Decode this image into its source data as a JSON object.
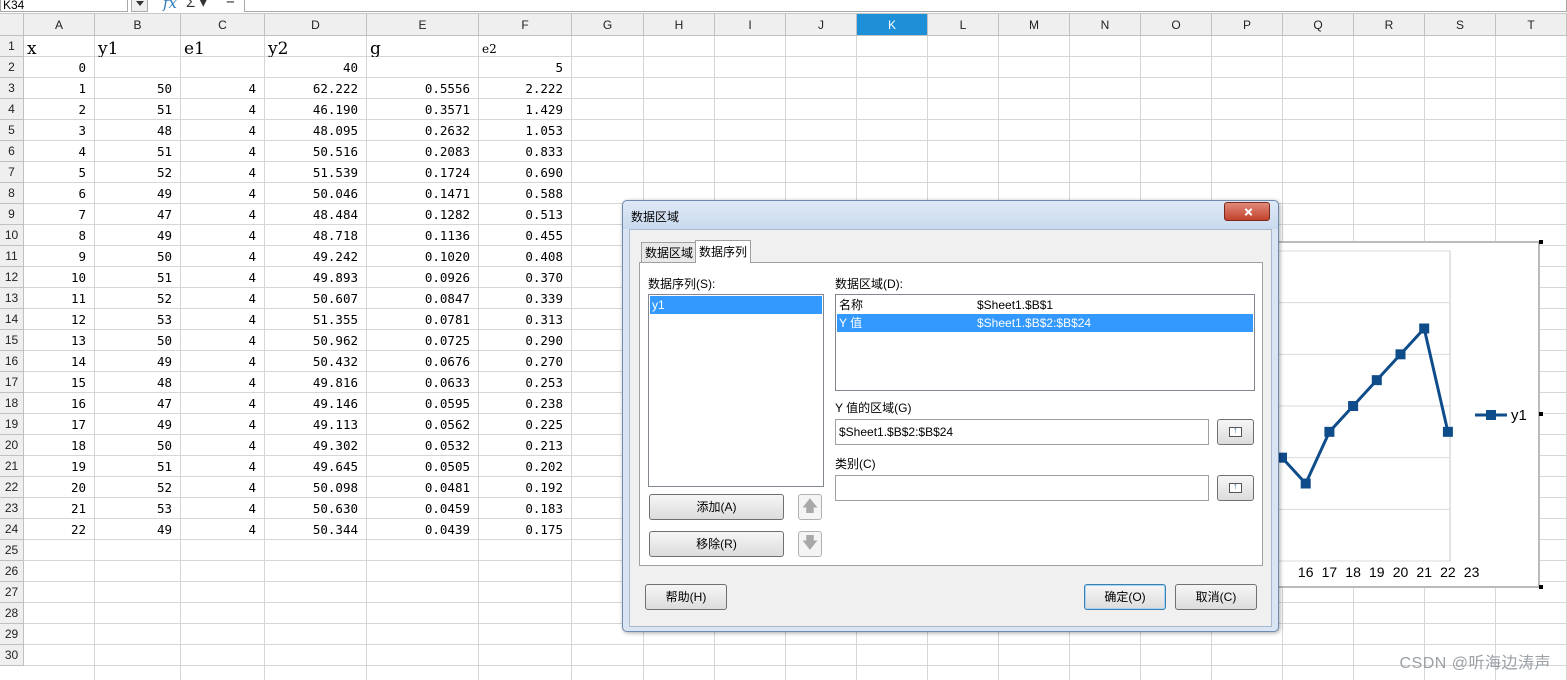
{
  "formula_bar": {
    "name_box": "K34",
    "fx_label": "fx",
    "sigma_label": "Σ ▾",
    "equals_label": "="
  },
  "columns": [
    "A",
    "B",
    "C",
    "D",
    "E",
    "F",
    "G",
    "H",
    "I",
    "J",
    "K",
    "L",
    "M",
    "N",
    "O",
    "P",
    "Q",
    "R",
    "S",
    "T"
  ],
  "active_column": "K",
  "rows": [
    "1",
    "2",
    "3",
    "4",
    "5",
    "6",
    "7",
    "8",
    "9",
    "10",
    "11",
    "12",
    "13",
    "14",
    "15",
    "16",
    "17",
    "18",
    "19",
    "20",
    "21",
    "22",
    "23",
    "24",
    "25",
    "26",
    "27",
    "28",
    "29",
    "30"
  ],
  "sheet": {
    "header": [
      "x",
      "y1",
      "e1",
      "y2",
      "g",
      "e2"
    ],
    "data": [
      [
        "0",
        "",
        "",
        "40",
        "",
        "5"
      ],
      [
        "1",
        "50",
        "4",
        "62.222",
        "0.5556",
        "2.222"
      ],
      [
        "2",
        "51",
        "4",
        "46.190",
        "0.3571",
        "1.429"
      ],
      [
        "3",
        "48",
        "4",
        "48.095",
        "0.2632",
        "1.053"
      ],
      [
        "4",
        "51",
        "4",
        "50.516",
        "0.2083",
        "0.833"
      ],
      [
        "5",
        "52",
        "4",
        "51.539",
        "0.1724",
        "0.690"
      ],
      [
        "6",
        "49",
        "4",
        "50.046",
        "0.1471",
        "0.588"
      ],
      [
        "7",
        "47",
        "4",
        "48.484",
        "0.1282",
        "0.513"
      ],
      [
        "8",
        "49",
        "4",
        "48.718",
        "0.1136",
        "0.455"
      ],
      [
        "9",
        "50",
        "4",
        "49.242",
        "0.1020",
        "0.408"
      ],
      [
        "10",
        "51",
        "4",
        "49.893",
        "0.0926",
        "0.370"
      ],
      [
        "11",
        "52",
        "4",
        "50.607",
        "0.0847",
        "0.339"
      ],
      [
        "12",
        "53",
        "4",
        "51.355",
        "0.0781",
        "0.313"
      ],
      [
        "13",
        "50",
        "4",
        "50.962",
        "0.0725",
        "0.290"
      ],
      [
        "14",
        "49",
        "4",
        "50.432",
        "0.0676",
        "0.270"
      ],
      [
        "15",
        "48",
        "4",
        "49.816",
        "0.0633",
        "0.253"
      ],
      [
        "16",
        "47",
        "4",
        "49.146",
        "0.0595",
        "0.238"
      ],
      [
        "17",
        "49",
        "4",
        "49.113",
        "0.0562",
        "0.225"
      ],
      [
        "18",
        "50",
        "4",
        "49.302",
        "0.0532",
        "0.213"
      ],
      [
        "19",
        "51",
        "4",
        "49.645",
        "0.0505",
        "0.202"
      ],
      [
        "20",
        "52",
        "4",
        "50.098",
        "0.0481",
        "0.192"
      ],
      [
        "21",
        "53",
        "4",
        "50.630",
        "0.0459",
        "0.183"
      ],
      [
        "22",
        "49",
        "4",
        "50.344",
        "0.0439",
        "0.175"
      ]
    ]
  },
  "chart": {
    "type": "line",
    "visible_x_labels": [
      "16",
      "17",
      "18",
      "19",
      "20",
      "21",
      "22",
      "23"
    ],
    "series_name": "y1",
    "visible_points": [
      {
        "x": 15,
        "y": 48
      },
      {
        "x": 16,
        "y": 47
      },
      {
        "x": 17,
        "y": 49
      },
      {
        "x": 18,
        "y": 50
      },
      {
        "x": 19,
        "y": 51
      },
      {
        "x": 20,
        "y": 52
      },
      {
        "x": 21,
        "y": 53
      },
      {
        "x": 22,
        "y": 49
      }
    ],
    "y_range": [
      44,
      56
    ],
    "line_color": "#0f4c8a",
    "legend_position": "right"
  },
  "dialog": {
    "title": "数据区域",
    "tabs": [
      "数据区域",
      "数据序列"
    ],
    "active_tab": 1,
    "series_list_label": "数据序列(S):",
    "series_items": [
      "y1"
    ],
    "data_range_label": "数据区域(D):",
    "data_ranges": [
      {
        "role": "名称",
        "range": "$Sheet1.$B$1"
      },
      {
        "role": "Y 值",
        "range": "$Sheet1.$B$2:$B$24"
      }
    ],
    "selected_range_index": 1,
    "y_range_label": "Y 值的区域(G)",
    "y_range_value": "$Sheet1.$B$2:$B$24",
    "categories_label": "类别(C)",
    "categories_value": "",
    "add_button": "添加(A)",
    "remove_button": "移除(R)",
    "move_up_glyph": "🡅",
    "move_down_glyph": "🡇",
    "help_button": "帮助(H)",
    "ok_button": "确定(O)",
    "cancel_button": "取消(C)"
  },
  "watermark": "CSDN @听海边涛声"
}
